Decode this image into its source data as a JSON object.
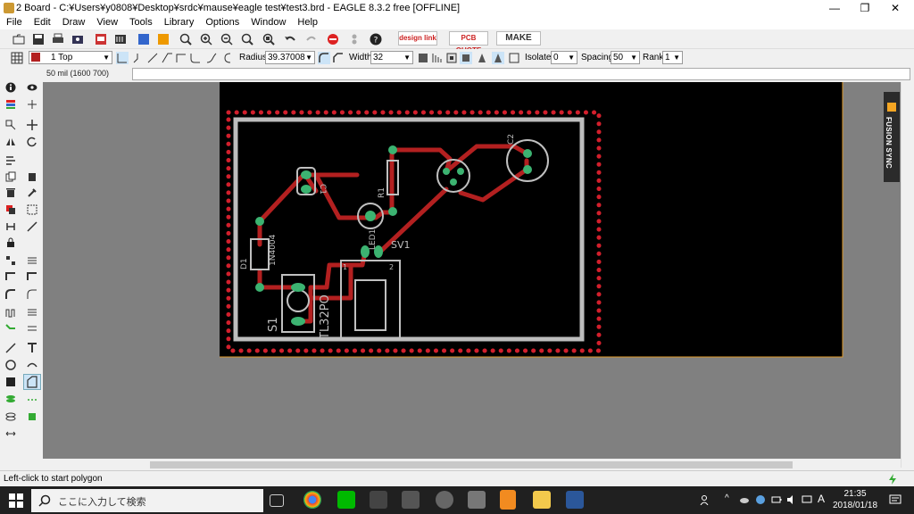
{
  "window": {
    "title": "2 Board - C:¥Users¥y0808¥Desktop¥srdc¥mause¥eagle test¥test3.brd - EAGLE 8.3.2 free [OFFLINE]",
    "minimize": "—",
    "restore": "❐",
    "close": "✕"
  },
  "menu": [
    "File",
    "Edit",
    "Draw",
    "View",
    "Tools",
    "Library",
    "Options",
    "Window",
    "Help"
  ],
  "toolbar": {
    "design_link": "design link",
    "pcb_quote": "PCB QUOTE",
    "make": "MAKE"
  },
  "params": {
    "layer": "1 Top",
    "radius_label": "Radius:",
    "radius_value": "39.37008",
    "width_label": "Width:",
    "width_value": "32",
    "isolate_label": "Isolate:",
    "isolate_value": "0",
    "spacing_label": "Spacing:",
    "spacing_value": "50",
    "rank_label": "Rank:",
    "rank_value": "1"
  },
  "coord_readout": "50 mil (1600 700)",
  "side_tab": "FUSION SYNC",
  "status": "Left-click to start polygon",
  "board": {
    "labels": {
      "c1": "C1",
      "c2": "C2",
      "r1": "R1",
      "led1": "LED1",
      "sv1": "SV1",
      "d1": "D1",
      "d1_val": "1N4004",
      "s1": "S1",
      "s1_val": "TL32PO",
      "pin1": "1",
      "pin2": "2"
    },
    "colors": {
      "background": "#000000",
      "copper": "#b32020",
      "pads": "#3cb371",
      "silk": "#c0c0c0",
      "outline": "#f0a030"
    }
  },
  "taskbar": {
    "search_placeholder": "ここに入力して検索",
    "time": "21:35",
    "date": "2018/01/18",
    "ime": "A"
  }
}
